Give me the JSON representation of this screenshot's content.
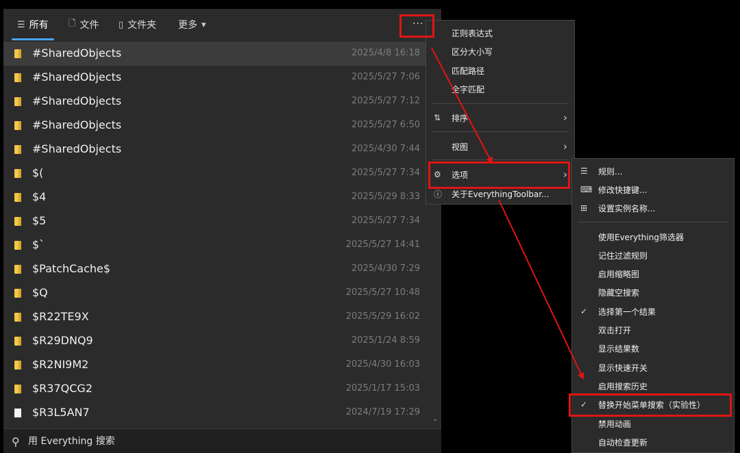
{
  "tabs": [
    {
      "icon": "list-icon",
      "glyph": "☰",
      "label": "所有"
    },
    {
      "icon": "file-icon",
      "glyph": "🗋",
      "label": "文件"
    },
    {
      "icon": "folder-icon",
      "glyph": "▯",
      "label": "文件夹"
    },
    {
      "label": "更多",
      "caret": "▾"
    }
  ],
  "more_button": "···",
  "rows": [
    {
      "name": "#SharedObjects",
      "date": "2025/4/8 16:18",
      "type": "folder"
    },
    {
      "name": "#SharedObjects",
      "date": "2025/5/27 7:06",
      "type": "folder"
    },
    {
      "name": "#SharedObjects",
      "date": "2025/5/27 7:12",
      "type": "folder"
    },
    {
      "name": "#SharedObjects",
      "date": "2025/5/27 6:50",
      "type": "folder"
    },
    {
      "name": "#SharedObjects",
      "date": "2025/4/30 7:44",
      "type": "folder"
    },
    {
      "name": "$(",
      "date": "2025/5/27 7:34",
      "type": "folder"
    },
    {
      "name": "$4",
      "date": "2025/5/29 8:33",
      "type": "folder"
    },
    {
      "name": "$5",
      "date": "2025/5/27 7:34",
      "type": "folder"
    },
    {
      "name": "$`",
      "date": "2025/5/27 14:41",
      "type": "folder"
    },
    {
      "name": "$PatchCache$",
      "date": "2025/4/30 7:29",
      "type": "folder"
    },
    {
      "name": "$Q",
      "date": "2025/5/27 10:48",
      "type": "folder"
    },
    {
      "name": "$R22TE9X",
      "date": "2025/5/29 16:02",
      "type": "folder"
    },
    {
      "name": "$R29DNQ9",
      "date": "2025/1/24 8:59",
      "type": "folder"
    },
    {
      "name": "$R2NI9M2",
      "date": "2025/4/30 16:03",
      "type": "folder"
    },
    {
      "name": "$R37QCG2",
      "date": "2025/1/17 15:03",
      "type": "folder"
    },
    {
      "name": "$R3L5AN7",
      "date": "2024/7/19 17:29",
      "type": "file"
    }
  ],
  "search": {
    "placeholder": "用 Everything 搜索",
    "value": ""
  },
  "menu1": {
    "items": [
      {
        "label": "正则表达式"
      },
      {
        "label": "区分大小写"
      },
      {
        "label": "匹配路径"
      },
      {
        "label": "全字匹配"
      },
      {
        "label": "排序",
        "icon": "sort-icon",
        "glyph": "⇅",
        "submenu": true
      },
      {
        "label": "视图",
        "submenu": true
      },
      {
        "label": "选项",
        "icon": "gear-icon",
        "glyph": "⚙",
        "submenu": true
      },
      {
        "label": "关于EverythingToolbar...",
        "icon": "info-icon",
        "glyph": "ⓘ"
      }
    ]
  },
  "menu2": {
    "items": [
      {
        "label": "规则...",
        "icon": "rules-icon",
        "glyph": "☰"
      },
      {
        "label": "修改快捷键...",
        "icon": "keyboard-icon",
        "glyph": "⌨"
      },
      {
        "label": "设置实例名称...",
        "icon": "instance-icon",
        "glyph": "⊞"
      },
      {
        "label": "使用Everything筛选器"
      },
      {
        "label": "记住过滤规则"
      },
      {
        "label": "启用缩略图"
      },
      {
        "label": "隐藏空搜索"
      },
      {
        "label": "选择第一个结果",
        "checked": true
      },
      {
        "label": "双击打开"
      },
      {
        "label": "显示结果数"
      },
      {
        "label": "显示快速开关"
      },
      {
        "label": "启用搜索历史"
      },
      {
        "label": "替换开始菜单搜索（实验性）",
        "checked": true
      },
      {
        "label": "禁用动画"
      },
      {
        "label": "自动检查更新"
      }
    ]
  },
  "check_glyph": "✓",
  "chevron_glyph": "›",
  "colors": {
    "accent": "#4aa3ef",
    "highlight": "#e01515",
    "folder": "#f2c84b"
  }
}
